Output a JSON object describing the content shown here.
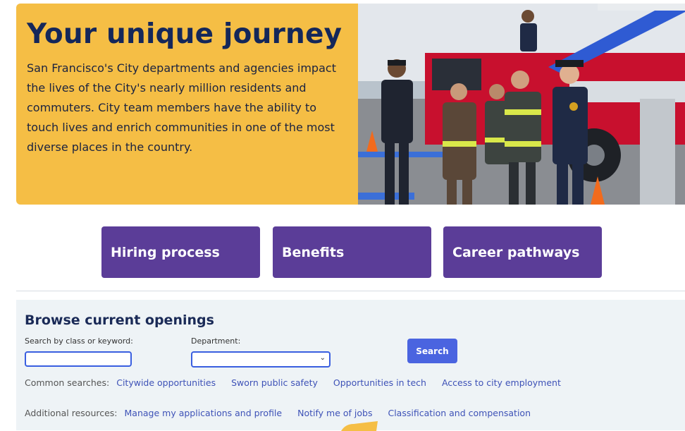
{
  "hero": {
    "title": "Your unique journey",
    "body": "San Francisco's City departments and agencies impact the lives of the City's nearly million residents and commuters. City team members have the ability to touch lives and enrich communities in one of the most diverse places in the country."
  },
  "cards": [
    {
      "label": "Hiring process"
    },
    {
      "label": "Benefits"
    },
    {
      "label": "Career pathways"
    }
  ],
  "browse": {
    "title": "Browse current openings",
    "keyword_label": "Search by class or keyword:",
    "keyword_value": "",
    "department_label": "Department:",
    "department_value": "",
    "search_label": "Search",
    "common_label": "Common searches:",
    "common_links": [
      "Citywide opportunities",
      "Sworn public safety",
      "Opportunities in tech",
      "Access to city employment"
    ],
    "additional_label": "Additional resources:",
    "additional_links": [
      "Manage my applications and profile",
      "Notify me of jobs",
      "Classification and compensation"
    ]
  },
  "colors": {
    "hero_bg": "#f5be45",
    "card_bg": "#5b3d98",
    "search_button": "#4a64e0",
    "link": "#3e52b7",
    "browse_bg": "#eef3f6"
  }
}
